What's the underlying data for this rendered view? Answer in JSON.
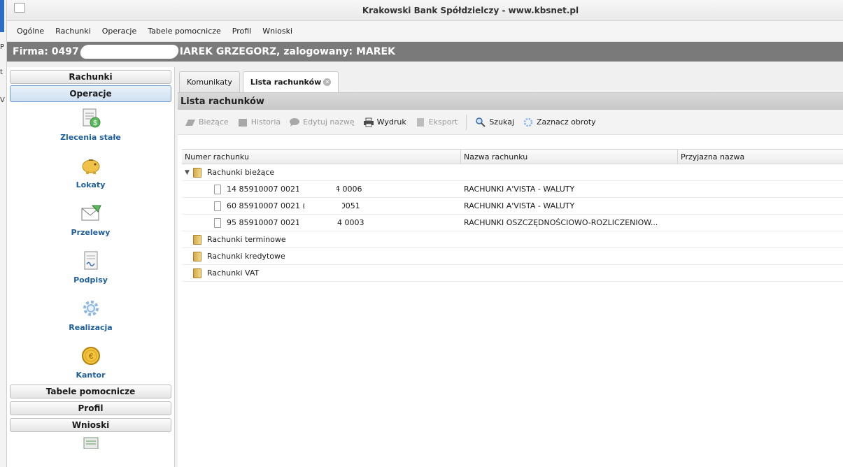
{
  "window": {
    "title": "Krakowski Bank Spółdzielczy - www.kbsnet.pl"
  },
  "desk_strip": {
    "chars": [
      "P",
      "t",
      "V"
    ]
  },
  "menu": [
    "Ogólne",
    "Rachunki",
    "Operacje",
    "Tabele pomocnicze",
    "Profil",
    "Wnioski"
  ],
  "firm": {
    "prefix": "Firma: 0497",
    "suffix": "IAREK GRZEGORZ, zalogowany: MAREK"
  },
  "sidebar": {
    "sections": {
      "rachunki": "Rachunki",
      "operacje": "Operacje",
      "tabele": "Tabele pomocnicze",
      "profil": "Profil",
      "wnioski": "Wnioski"
    },
    "items": [
      {
        "label": "Zlecenia stałe",
        "icon": "standing-order-icon"
      },
      {
        "label": "Lokaty",
        "icon": "piggy-bank-icon"
      },
      {
        "label": "Przelewy",
        "icon": "envelope-icon"
      },
      {
        "label": "Podpisy",
        "icon": "signature-icon"
      },
      {
        "label": "Realizacja",
        "icon": "gear-icon"
      },
      {
        "label": "Kantor",
        "icon": "coin-icon"
      }
    ]
  },
  "tabs": [
    {
      "label": "Komunikaty"
    },
    {
      "label": "Lista rachunków"
    }
  ],
  "panel": {
    "title": "Lista rachunków",
    "toolbar": {
      "biezace": "Bieżące",
      "historia": "Historia",
      "edytuj": "Edytuj nazwę",
      "wydruk": "Wydruk",
      "eksport": "Eksport",
      "szukaj": "Szukaj",
      "zaznacz": "Zaznacz obroty"
    }
  },
  "grid": {
    "headers": [
      "Numer rachunku",
      "Nazwa rachunku",
      "Przyjazna nazwa"
    ],
    "group_open": "Rachunki bieżące",
    "rows": [
      {
        "num_a": "14 85910007 0021",
        "num_b": "4 0006",
        "name": "RACHUNKI A'VISTA - WALUTY"
      },
      {
        "num_a": "60 85910007 0021 (",
        "num_b": "0051",
        "name": "RACHUNKI A'VISTA - WALUTY"
      },
      {
        "num_a": "95 85910007 0021",
        "num_b": "'4 0003",
        "name": "RACHUNKI OSZCZĘDNOŚCIOWO-ROZLICZENIOW..."
      }
    ],
    "groups_closed": [
      "Rachunki terminowe",
      "Rachunki kredytowe",
      "Rachunki VAT"
    ]
  }
}
